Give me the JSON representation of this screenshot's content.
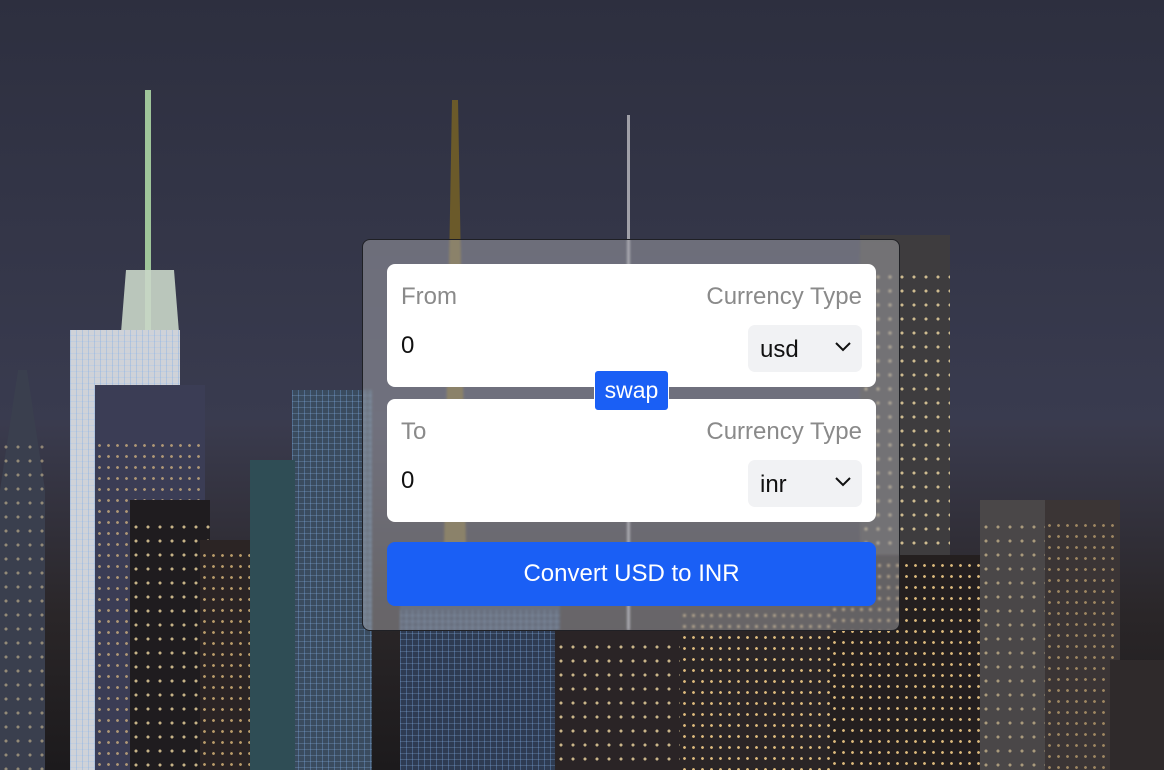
{
  "converter": {
    "from": {
      "label": "From",
      "currency_label": "Currency Type",
      "amount": "0",
      "currency": "usd"
    },
    "swap_label": "swap",
    "to": {
      "label": "To",
      "currency_label": "Currency Type",
      "amount": "0",
      "currency": "inr"
    },
    "convert_label": "Convert USD to INR"
  },
  "icons": {
    "select_chevron": "chevron-down-icon"
  },
  "colors": {
    "accent": "#1a5ff5",
    "panel": "#ffffff",
    "label": "#8a8a8a"
  }
}
